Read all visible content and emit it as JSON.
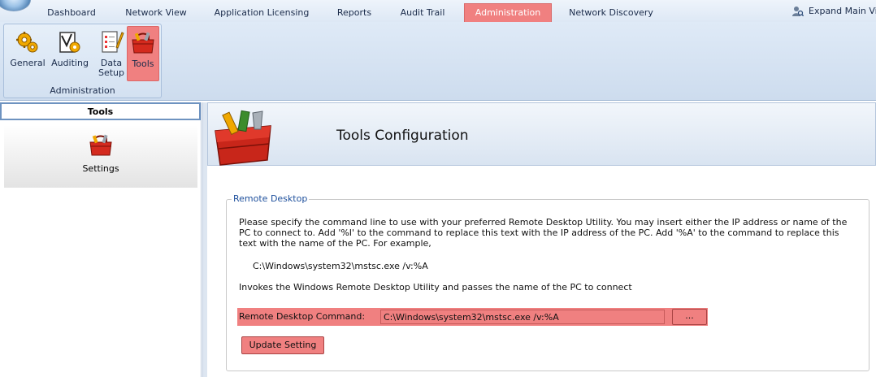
{
  "tabs": [
    {
      "label": "Dashboard"
    },
    {
      "label": "Network View"
    },
    {
      "label": "Application Licensing"
    },
    {
      "label": "Reports"
    },
    {
      "label": "Audit Trail"
    },
    {
      "label": "Administration",
      "active": true
    },
    {
      "label": "Network Discovery"
    }
  ],
  "expand_main_view": "Expand Main View",
  "ribbon": {
    "buttons": [
      {
        "label": "General",
        "icon": "gear-icon"
      },
      {
        "label": "Auditing",
        "icon": "clipboard-gear-icon"
      },
      {
        "label": "Data\nSetup",
        "line1": "Data",
        "line2": "Setup",
        "icon": "checklist-pencil-icon"
      },
      {
        "label": "Tools",
        "icon": "toolbox-icon",
        "active": true
      }
    ],
    "group_label": "Administration"
  },
  "left_panel": {
    "header": "Tools",
    "items": [
      {
        "label": "Settings",
        "icon": "toolbox-icon"
      }
    ]
  },
  "main": {
    "title": "Tools Configuration",
    "section_legend": "Remote Desktop",
    "description": "Please specify the command line to use with your preferred Remote Desktop Utility.  You may insert either the IP address or name of the PC to connect to.  Add '%I' to the command to replace this text with the IP address of the PC.  Add '%A' to the command to replace this text with the name of the PC.  For example,",
    "example": "C:\\Windows\\system32\\mstsc.exe /v:%A",
    "invokes_text": "Invokes the Windows Remote Desktop Utility and passes the name of the PC to connect",
    "command_label": "Remote Desktop Command:",
    "command_value": "C:\\Windows\\system32\\mstsc.exe /v:%A",
    "browse_label": "...",
    "update_label": "Update Setting"
  },
  "colors": {
    "highlight": "#f08080",
    "legend_text": "#1d4f9c",
    "tab_text": "#1a2b4a"
  }
}
